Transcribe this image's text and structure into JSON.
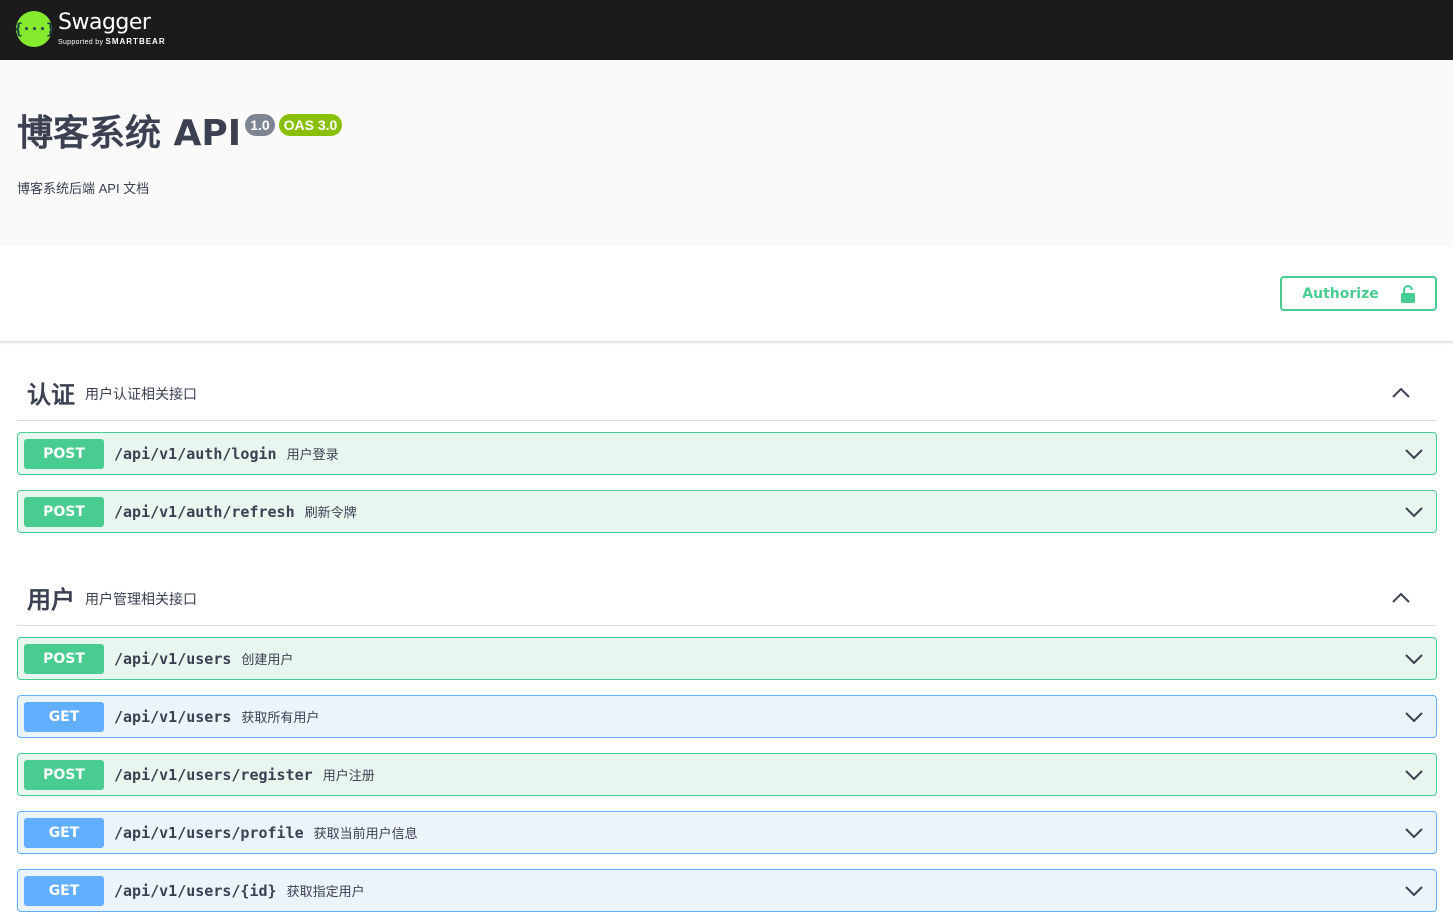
{
  "topbar": {
    "logo_symbol": "{···}",
    "logo_name": "Swagger",
    "logo_sub_prefix": "Supported by ",
    "logo_sub_brand": "SMARTBEAR"
  },
  "info": {
    "title": "博客系统 API",
    "version": "1.0",
    "oas": "OAS 3.0",
    "description": "博客系统后端 API 文档"
  },
  "auth": {
    "label": "Authorize",
    "icon": "unlocked-lock-icon",
    "color": "#49cc90"
  },
  "colors": {
    "post": "#49cc90",
    "get": "#61affe"
  },
  "tags": [
    {
      "name": "认证",
      "description": "用户认证相关接口",
      "operations": [
        {
          "method": "POST",
          "path": "/api/v1/auth/login",
          "summary": "用户登录"
        },
        {
          "method": "POST",
          "path": "/api/v1/auth/refresh",
          "summary": "刷新令牌"
        }
      ]
    },
    {
      "name": "用户",
      "description": "用户管理相关接口",
      "operations": [
        {
          "method": "POST",
          "path": "/api/v1/users",
          "summary": "创建用户"
        },
        {
          "method": "GET",
          "path": "/api/v1/users",
          "summary": "获取所有用户"
        },
        {
          "method": "POST",
          "path": "/api/v1/users/register",
          "summary": "用户注册"
        },
        {
          "method": "GET",
          "path": "/api/v1/users/profile",
          "summary": "获取当前用户信息"
        },
        {
          "method": "GET",
          "path": "/api/v1/users/{id}",
          "summary": "获取指定用户"
        }
      ]
    }
  ]
}
